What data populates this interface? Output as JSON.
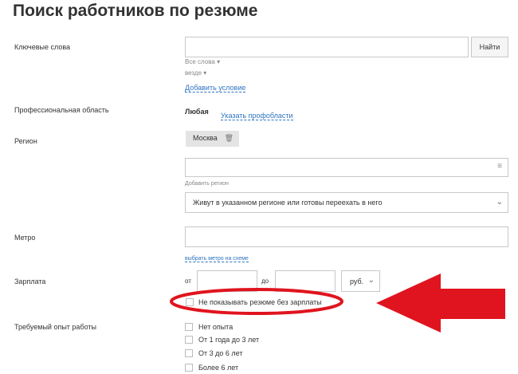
{
  "page": {
    "title": "Поиск работников по резюме"
  },
  "keywords": {
    "label": "Ключевые слова",
    "value": "",
    "search_button": "Найти",
    "all_words": "Все слова",
    "everywhere": "везде",
    "add_condition": "Добавить условие"
  },
  "prof_area": {
    "label": "Профессиональная область",
    "value": "Любая",
    "link": "Указать профобласти"
  },
  "region": {
    "label": "Регион",
    "chip": "Москва",
    "chip_icon": "trash-icon",
    "input_value": "",
    "add_region_hint": "Добавить регион",
    "relocation_select": "Живут в указанном регионе или готовы переехать в него"
  },
  "metro": {
    "label": "Метро",
    "value": "",
    "link": "выбрать метро на схеме"
  },
  "salary": {
    "label": "Зарплата",
    "from": "от",
    "to": "до",
    "currency": "руб.",
    "hide_without_salary": "Не показывать резюме без зарплаты"
  },
  "experience": {
    "label": "Требуемый опыт работы",
    "options": [
      "Нет опыта",
      "От 1 года до 3 лет",
      "От 3 до 6 лет",
      "Более 6 лет"
    ]
  },
  "annotation": {
    "circle_color": "#e0141e",
    "arrow_color": "#e0141e"
  }
}
